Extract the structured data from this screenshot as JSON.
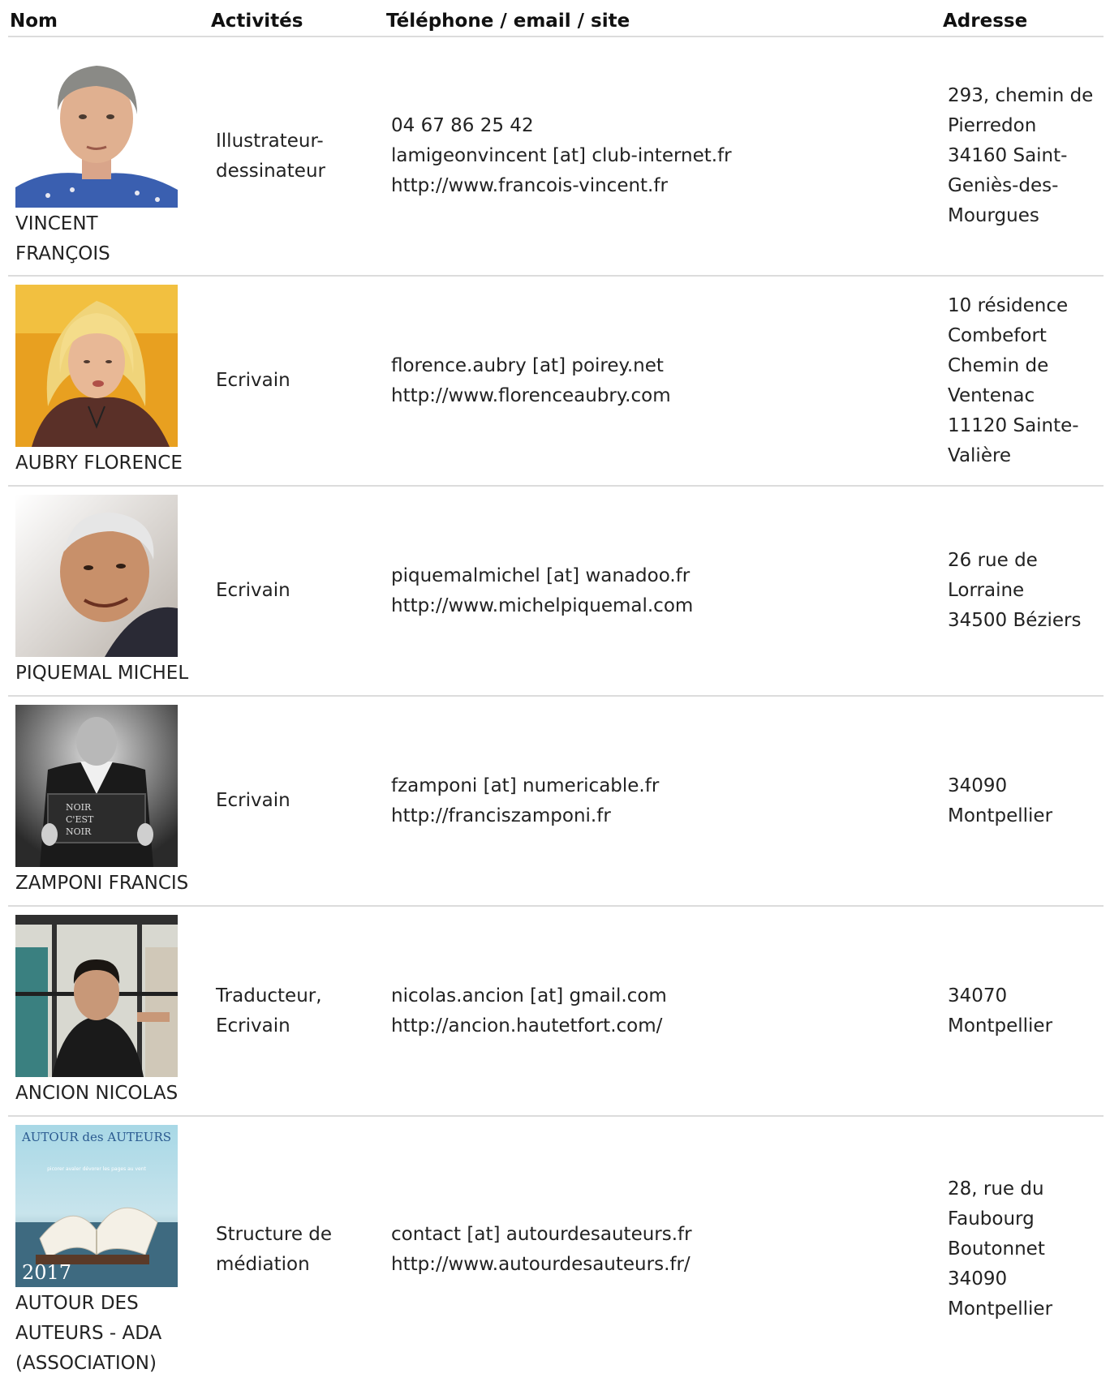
{
  "headers": {
    "name": "Nom",
    "activity": "Activités",
    "contact": "Téléphone / email / site",
    "address": "Adresse"
  },
  "rows": [
    {
      "name_lines": [
        "VINCENT",
        "FRANÇOIS"
      ],
      "activity_lines": [
        "Illustrateur-",
        "dessinateur"
      ],
      "contact_lines": [
        "04 67 86 25 42",
        "lamigeonvincent [at] club-internet.fr",
        "http://www.francois-vincent.fr"
      ],
      "address_lines": [
        "293, chemin de",
        "Pierredon",
        "34160 Saint-",
        "Geniès-des-",
        "Mourgues"
      ]
    },
    {
      "name_lines": [
        "AUBRY FLORENCE"
      ],
      "activity_lines": [
        "Ecrivain"
      ],
      "contact_lines": [
        "florence.aubry [at] poirey.net",
        "http://www.florenceaubry.com"
      ],
      "address_lines": [
        "10 résidence",
        "Combefort",
        "Chemin de",
        "Ventenac",
        "11120 Sainte-",
        "Valière"
      ]
    },
    {
      "name_lines": [
        "PIQUEMAL MICHEL"
      ],
      "activity_lines": [
        "Ecrivain"
      ],
      "contact_lines": [
        "piquemalmichel [at] wanadoo.fr",
        "http://www.michelpiquemal.com"
      ],
      "address_lines": [
        "26 rue de",
        "Lorraine",
        "34500 Béziers"
      ]
    },
    {
      "name_lines": [
        "ZAMPONI FRANCIS"
      ],
      "activity_lines": [
        "Ecrivain"
      ],
      "contact_lines": [
        "fzamponi [at] numericable.fr",
        "http://franciszamponi.fr"
      ],
      "address_lines": [
        "34090",
        "Montpellier"
      ],
      "photo_text": [
        "NOIR",
        "C'EST",
        "NOIR"
      ]
    },
    {
      "name_lines": [
        "ANCION NICOLAS"
      ],
      "activity_lines": [
        "Traducteur,",
        "Ecrivain"
      ],
      "contact_lines": [
        "nicolas.ancion [at] gmail.com",
        "http://ancion.hautetfort.com/"
      ],
      "address_lines": [
        "34070",
        "Montpellier"
      ]
    },
    {
      "name_lines": [
        "AUTOUR DES",
        "AUTEURS - ADA",
        "(ASSOCIATION)"
      ],
      "activity_lines": [
        "Structure de",
        "médiation"
      ],
      "contact_lines": [
        "contact [at] autourdesauteurs.fr",
        "http://www.autourdesauteurs.fr/"
      ],
      "address_lines": [
        "28, rue du",
        "Faubourg",
        "Boutonnet",
        "34090",
        "Montpellier"
      ],
      "photo_text": [
        "AUTOUR des AUTEURS",
        "picorer avaler dévorer les pages au vent",
        "2017"
      ]
    }
  ]
}
